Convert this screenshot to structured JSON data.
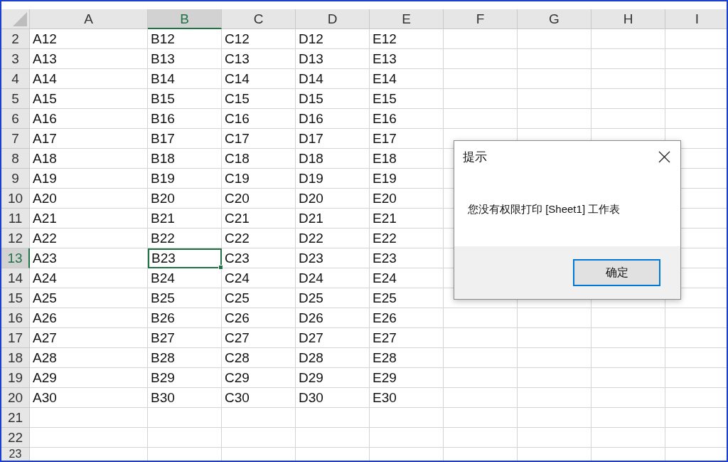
{
  "sheet": {
    "columns": [
      {
        "label": "A",
        "selected": false
      },
      {
        "label": "B",
        "selected": true
      },
      {
        "label": "C",
        "selected": false
      },
      {
        "label": "D",
        "selected": false
      },
      {
        "label": "E",
        "selected": false
      },
      {
        "label": "F",
        "selected": false
      },
      {
        "label": "G",
        "selected": false
      },
      {
        "label": "H",
        "selected": false
      },
      {
        "label": "I",
        "selected": false
      }
    ],
    "rows": [
      {
        "label": "2",
        "selected": false,
        "cells": [
          "A12",
          "B12",
          "C12",
          "D12",
          "E12"
        ]
      },
      {
        "label": "3",
        "selected": false,
        "cells": [
          "A13",
          "B13",
          "C13",
          "D13",
          "E13"
        ]
      },
      {
        "label": "4",
        "selected": false,
        "cells": [
          "A14",
          "B14",
          "C14",
          "D14",
          "E14"
        ]
      },
      {
        "label": "5",
        "selected": false,
        "cells": [
          "A15",
          "B15",
          "C15",
          "D15",
          "E15"
        ]
      },
      {
        "label": "6",
        "selected": false,
        "cells": [
          "A16",
          "B16",
          "C16",
          "D16",
          "E16"
        ]
      },
      {
        "label": "7",
        "selected": false,
        "cells": [
          "A17",
          "B17",
          "C17",
          "D17",
          "E17"
        ]
      },
      {
        "label": "8",
        "selected": false,
        "cells": [
          "A18",
          "B18",
          "C18",
          "D18",
          "E18"
        ]
      },
      {
        "label": "9",
        "selected": false,
        "cells": [
          "A19",
          "B19",
          "C19",
          "D19",
          "E19"
        ]
      },
      {
        "label": "10",
        "selected": false,
        "cells": [
          "A20",
          "B20",
          "C20",
          "D20",
          "E20"
        ]
      },
      {
        "label": "11",
        "selected": false,
        "cells": [
          "A21",
          "B21",
          "C21",
          "D21",
          "E21"
        ]
      },
      {
        "label": "12",
        "selected": false,
        "cells": [
          "A22",
          "B22",
          "C22",
          "D22",
          "E22"
        ]
      },
      {
        "label": "13",
        "selected": true,
        "cells": [
          "A23",
          "B23",
          "C23",
          "D23",
          "E23"
        ]
      },
      {
        "label": "14",
        "selected": false,
        "cells": [
          "A24",
          "B24",
          "C24",
          "D24",
          "E24"
        ]
      },
      {
        "label": "15",
        "selected": false,
        "cells": [
          "A25",
          "B25",
          "C25",
          "D25",
          "E25"
        ]
      },
      {
        "label": "16",
        "selected": false,
        "cells": [
          "A26",
          "B26",
          "C26",
          "D26",
          "E26"
        ]
      },
      {
        "label": "17",
        "selected": false,
        "cells": [
          "A27",
          "B27",
          "C27",
          "D27",
          "E27"
        ]
      },
      {
        "label": "18",
        "selected": false,
        "cells": [
          "A28",
          "B28",
          "C28",
          "D28",
          "E28"
        ]
      },
      {
        "label": "19",
        "selected": false,
        "cells": [
          "A29",
          "B29",
          "C29",
          "D29",
          "E29"
        ]
      },
      {
        "label": "20",
        "selected": false,
        "cells": [
          "A30",
          "B30",
          "C30",
          "D30",
          "E30"
        ]
      },
      {
        "label": "21",
        "selected": false,
        "cells": []
      },
      {
        "label": "22",
        "selected": false,
        "cells": []
      },
      {
        "label": "23",
        "selected": false,
        "cells": []
      }
    ]
  },
  "dialog": {
    "title": "提示",
    "message": "您没有权限打印 [Sheet1] 工作表",
    "button": "确定"
  }
}
